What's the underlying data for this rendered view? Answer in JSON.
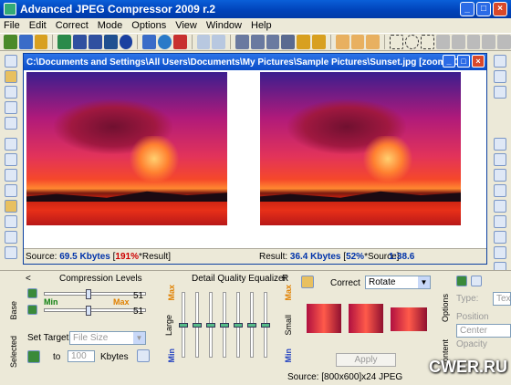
{
  "window": {
    "title": "Advanced JPEG Compressor 2009 r.2"
  },
  "menu": [
    "File",
    "Edit",
    "Correct",
    "Mode",
    "Options",
    "View",
    "Window",
    "Help"
  ],
  "document": {
    "title": "C:\\Documents and Settings\\All Users\\Documents\\My Pictures\\Sample Pictures\\Sunset.jpg  [zoom:40%]"
  },
  "status": {
    "source_label": "Source:",
    "source_size": "69.5 Kbytes",
    "source_pct": "191%",
    "source_suffix": "*Result",
    "result_label": "Result:",
    "result_size": "36.4 Kbytes",
    "result_pct": "52%",
    "result_suffix": "*Source",
    "ratio": "1:38.6"
  },
  "compression": {
    "title": "Compression Levels",
    "min": "Min",
    "max": "Max",
    "value1": "51",
    "value2": "51",
    "set_target": "Set Target",
    "target_select": "File Size",
    "to": "to",
    "target_value": "100",
    "unit": "Kbytes",
    "chevron": "<"
  },
  "equalizer": {
    "title": "Detail Quality Equalizer",
    "r": "R",
    "max": "Max",
    "min": "Min",
    "large": "Large",
    "small": "Small"
  },
  "correct": {
    "label": "Correct",
    "select": "Rotate",
    "apply": "Apply"
  },
  "right_panel": {
    "type": "Type:",
    "type_value": "Tex",
    "position": "Position",
    "position_value": "Center",
    "opacity": "Opacity"
  },
  "tabs": {
    "base": "Base",
    "selected": "Selected",
    "options": "Options",
    "content": "Content"
  },
  "bottom_status": "Source: [800x600]x24 JPEG",
  "brand": "CWER.RU"
}
